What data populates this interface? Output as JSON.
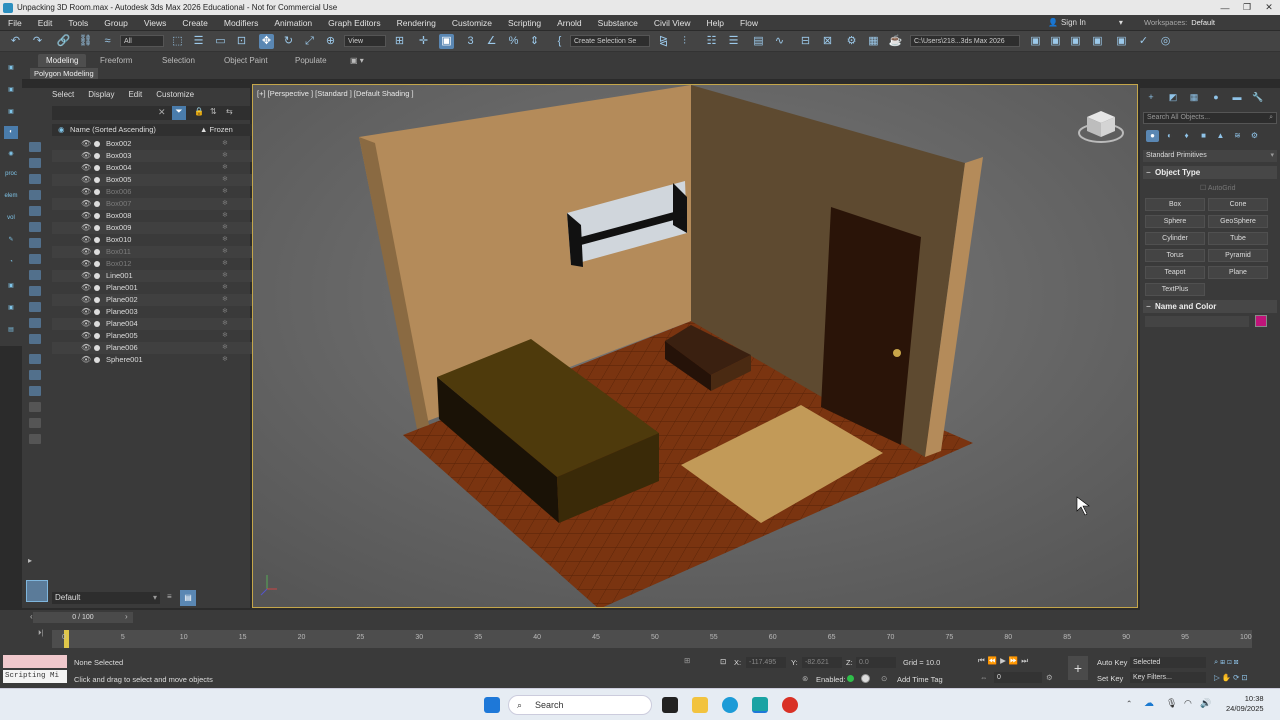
{
  "window": {
    "title": "Unpacking 3D Room.max - Autodesk 3ds Max 2026 Educational - Not for Commercial Use"
  },
  "menu": [
    "File",
    "Edit",
    "Tools",
    "Group",
    "Views",
    "Create",
    "Modifiers",
    "Animation",
    "Graph Editors",
    "Rendering",
    "Customize",
    "Scripting",
    "Arnold",
    "Substance",
    "Civil View",
    "Help",
    "Flow"
  ],
  "account": {
    "signin": "Sign In",
    "workspaces_label": "Workspaces:",
    "workspace": "Default"
  },
  "toolbar": {
    "filter": "All",
    "view": "View",
    "selection_set": "Create Selection Se",
    "path": "C:\\Users\\218...3ds Max 2026"
  },
  "ribbon": {
    "tabs": [
      "Modeling",
      "Freeform",
      "Selection",
      "Object Paint",
      "Populate"
    ],
    "subtab": "Polygon Modeling"
  },
  "scene_explorer": {
    "menu": [
      "Select",
      "Display",
      "Edit",
      "Customize"
    ],
    "header_name": "Name (Sorted Ascending)",
    "header_frozen": "▲ Frozen",
    "rows": [
      "Box002",
      "Box003",
      "Box004",
      "Box005",
      "Box006",
      "Box007",
      "Box008",
      "Box009",
      "Box010",
      "Box011",
      "Box012",
      "Line001",
      "Plane001",
      "Plane002",
      "Plane003",
      "Plane004",
      "Plane005",
      "Plane006",
      "Sphere001"
    ],
    "layer": "Default"
  },
  "viewport": {
    "label": "[+] [Perspective ] [Standard ] [Default Shading ]"
  },
  "command_panel": {
    "search": "Search All Objects...",
    "category": "Standard Primitives",
    "object_type_header": "Object Type",
    "autogrid": "AutoGrid",
    "buttons": [
      "Box",
      "Cone",
      "Sphere",
      "GeoSphere",
      "Cylinder",
      "Tube",
      "Torus",
      "Pyramid",
      "Teapot",
      "Plane",
      "TextPlus"
    ],
    "name_color_header": "Name and Color",
    "object_color": "#c0147a"
  },
  "timeline": {
    "slider": "0 / 100",
    "ticks": [
      "0",
      "5",
      "10",
      "15",
      "20",
      "25",
      "30",
      "35",
      "40",
      "45",
      "50",
      "55",
      "60",
      "65",
      "70",
      "75",
      "80",
      "85",
      "90",
      "95",
      "100"
    ]
  },
  "status": {
    "selected": "None Selected",
    "prompt": "Click and drag to select and move objects",
    "listener": "Scripting Mi",
    "x_label": "X:",
    "x": "-117.495",
    "y_label": "Y:",
    "y": "-82.621",
    "z_label": "Z:",
    "z": "0.0",
    "grid": "Grid = 10.0",
    "enabled": "Enabled:",
    "add_time_tag": "Add Time Tag",
    "auto_key": "Auto Key",
    "set_key": "Set Key",
    "key_mode": "Selected",
    "key_filters": "Key Filters...",
    "frame": "0"
  },
  "taskbar": {
    "search": "Search",
    "time": "10:38",
    "date": "24/09/2025"
  }
}
